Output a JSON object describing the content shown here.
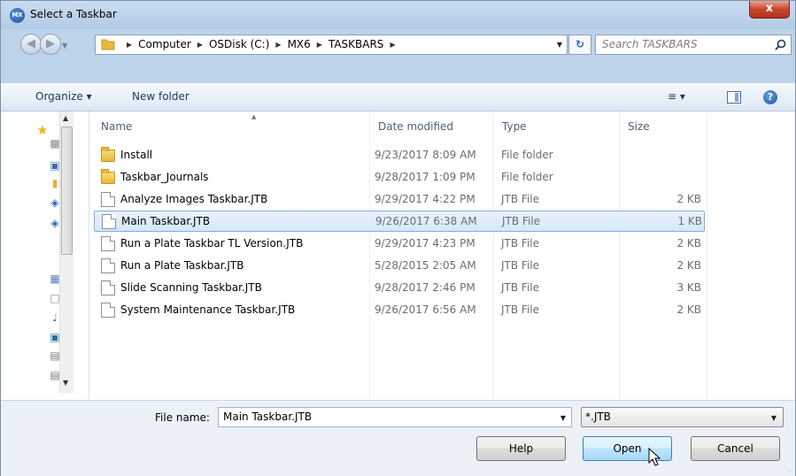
{
  "window": {
    "title": "Select a Taskbar",
    "app_icon_text": "MX",
    "close_label": "x"
  },
  "address_bar": {
    "crumbs": [
      "Computer",
      "OSDisk (C:)",
      "MX6",
      "TASKBARS"
    ],
    "search_placeholder": "Search TASKBARS"
  },
  "toolbar": {
    "organize_label": "Organize ▾",
    "new_folder_label": "New folder",
    "help_label": "?"
  },
  "columns": {
    "name": "Name",
    "date": "Date modified",
    "type": "Type",
    "size": "Size"
  },
  "files": [
    {
      "name": "Install",
      "date": "9/23/2017 8:09 AM",
      "type": "File folder",
      "size": "",
      "icon": "folder-icon",
      "selected": false
    },
    {
      "name": "Taskbar_Journals",
      "date": "9/28/2017 1:09 PM",
      "type": "File folder",
      "size": "",
      "icon": "folder-icon",
      "selected": false
    },
    {
      "name": "Analyze Images Taskbar.JTB",
      "date": "9/29/2017 4:22 PM",
      "type": "JTB File",
      "size": "2 KB",
      "icon": "document-icon",
      "selected": false
    },
    {
      "name": "Main Taskbar.JTB",
      "date": "9/26/2017 6:38 AM",
      "type": "JTB File",
      "size": "1 KB",
      "icon": "document-icon",
      "selected": true
    },
    {
      "name": "Run a Plate Taskbar TL Version.JTB",
      "date": "9/29/2017 4:23 PM",
      "type": "JTB File",
      "size": "2 KB",
      "icon": "document-icon",
      "selected": false
    },
    {
      "name": "Run a Plate Taskbar.JTB",
      "date": "5/28/2015 2:05 AM",
      "type": "JTB File",
      "size": "2 KB",
      "icon": "document-icon",
      "selected": false
    },
    {
      "name": "Slide Scanning Taskbar.JTB",
      "date": "9/28/2017 2:46 PM",
      "type": "JTB File",
      "size": "3 KB",
      "icon": "document-icon",
      "selected": false
    },
    {
      "name": "System Maintenance Taskbar.JTB",
      "date": "9/26/2017 6:56 AM",
      "type": "JTB File",
      "size": "2 KB",
      "icon": "document-icon",
      "selected": false
    }
  ],
  "bottom": {
    "file_name_label": "File name:",
    "file_name_value": "Main Taskbar.JTB",
    "file_type_value": "*.JTB",
    "help_button": "Help",
    "open_button": "Open",
    "cancel_button": "Cancel"
  },
  "colors": {
    "selection": "#d6e8fb",
    "accent": "#3c7fb1"
  }
}
